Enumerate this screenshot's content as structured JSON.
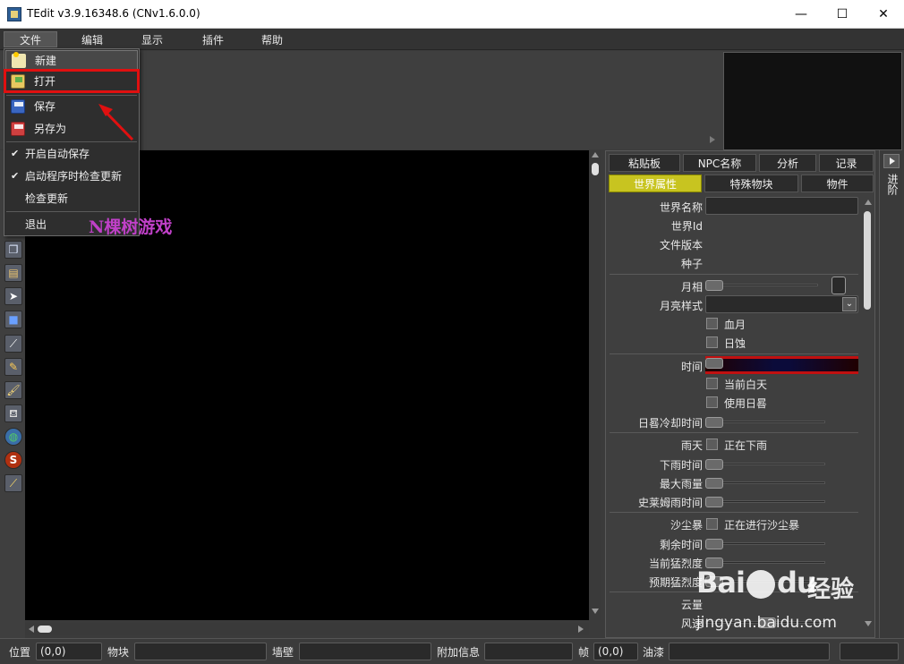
{
  "window": {
    "title": "TEdit v3.9.16348.6 (CNv1.6.0.0)",
    "minimize": "—",
    "maximize": "☐",
    "close": "✕"
  },
  "menubar": {
    "file": "文件",
    "edit": "编辑",
    "view": "显示",
    "plugins": "插件",
    "help": "帮助"
  },
  "file_menu": {
    "new": "新建",
    "open": "打开",
    "save": "保存",
    "save_as": "另存为",
    "autosave": "开启自动保存",
    "check_updates_on_start": "启动程序时检查更新",
    "check_update": "检查更新",
    "exit": "退出",
    "check_mark": "✔"
  },
  "annotation": {
    "watermark": "N棵树游戏",
    "highlight_color": "#e01010"
  },
  "panel": {
    "tabs_row1": [
      "粘贴板",
      "NPC名称",
      "分析",
      "记录"
    ],
    "tabs_row2": [
      "世界属性",
      "特殊物块",
      "物件"
    ],
    "active_tab_color": "#c8c420",
    "labels": {
      "world_name": "世界名称",
      "world_id": "世界Id",
      "file_version": "文件版本",
      "seed": "种子",
      "moon_phase": "月相",
      "moon_style": "月亮样式",
      "blood_moon": "血月",
      "eclipse": "日蚀",
      "time": "时间",
      "day_time": "当前白天",
      "use_sundial": "使用日晷",
      "sundial_cooldown": "日晷冷却时间",
      "rain": "雨天",
      "raining": "正在下雨",
      "rain_time": "下雨时间",
      "max_rain": "最大雨量",
      "slime_rain_time": "史莱姆雨时间",
      "sandstorm": "沙尘暴",
      "sandstorm_active": "正在进行沙尘暴",
      "time_left": "剩余时间",
      "severity": "当前猛烈度",
      "intended_severity": "预期猛烈度",
      "clouds": "云量",
      "wind": "风速"
    },
    "moon_style_dropdown_icon": "⌄"
  },
  "side_tab": {
    "label": "进阶"
  },
  "statusbar": {
    "position_label": "位置",
    "position_value": "(0,0)",
    "tile_label": "物块",
    "wall_label": "墙壁",
    "extra_label": "附加信息",
    "frame_label": "帧",
    "frame_value": "(0,0)",
    "paint_label": "油漆"
  },
  "tools": {
    "copy": "❐",
    "paste": "▤",
    "arrow": "➤",
    "rect": "■",
    "picker": "⟋",
    "pencil": "✎",
    "brush": "🖌",
    "bucket": "⛾",
    "globe": "◍",
    "sprite": "S",
    "morph": "⟋"
  },
  "watermark": {
    "logo_a": "Bai",
    "logo_b": "du",
    "cn": "经验",
    "url": "jingyan.baidu.com"
  }
}
